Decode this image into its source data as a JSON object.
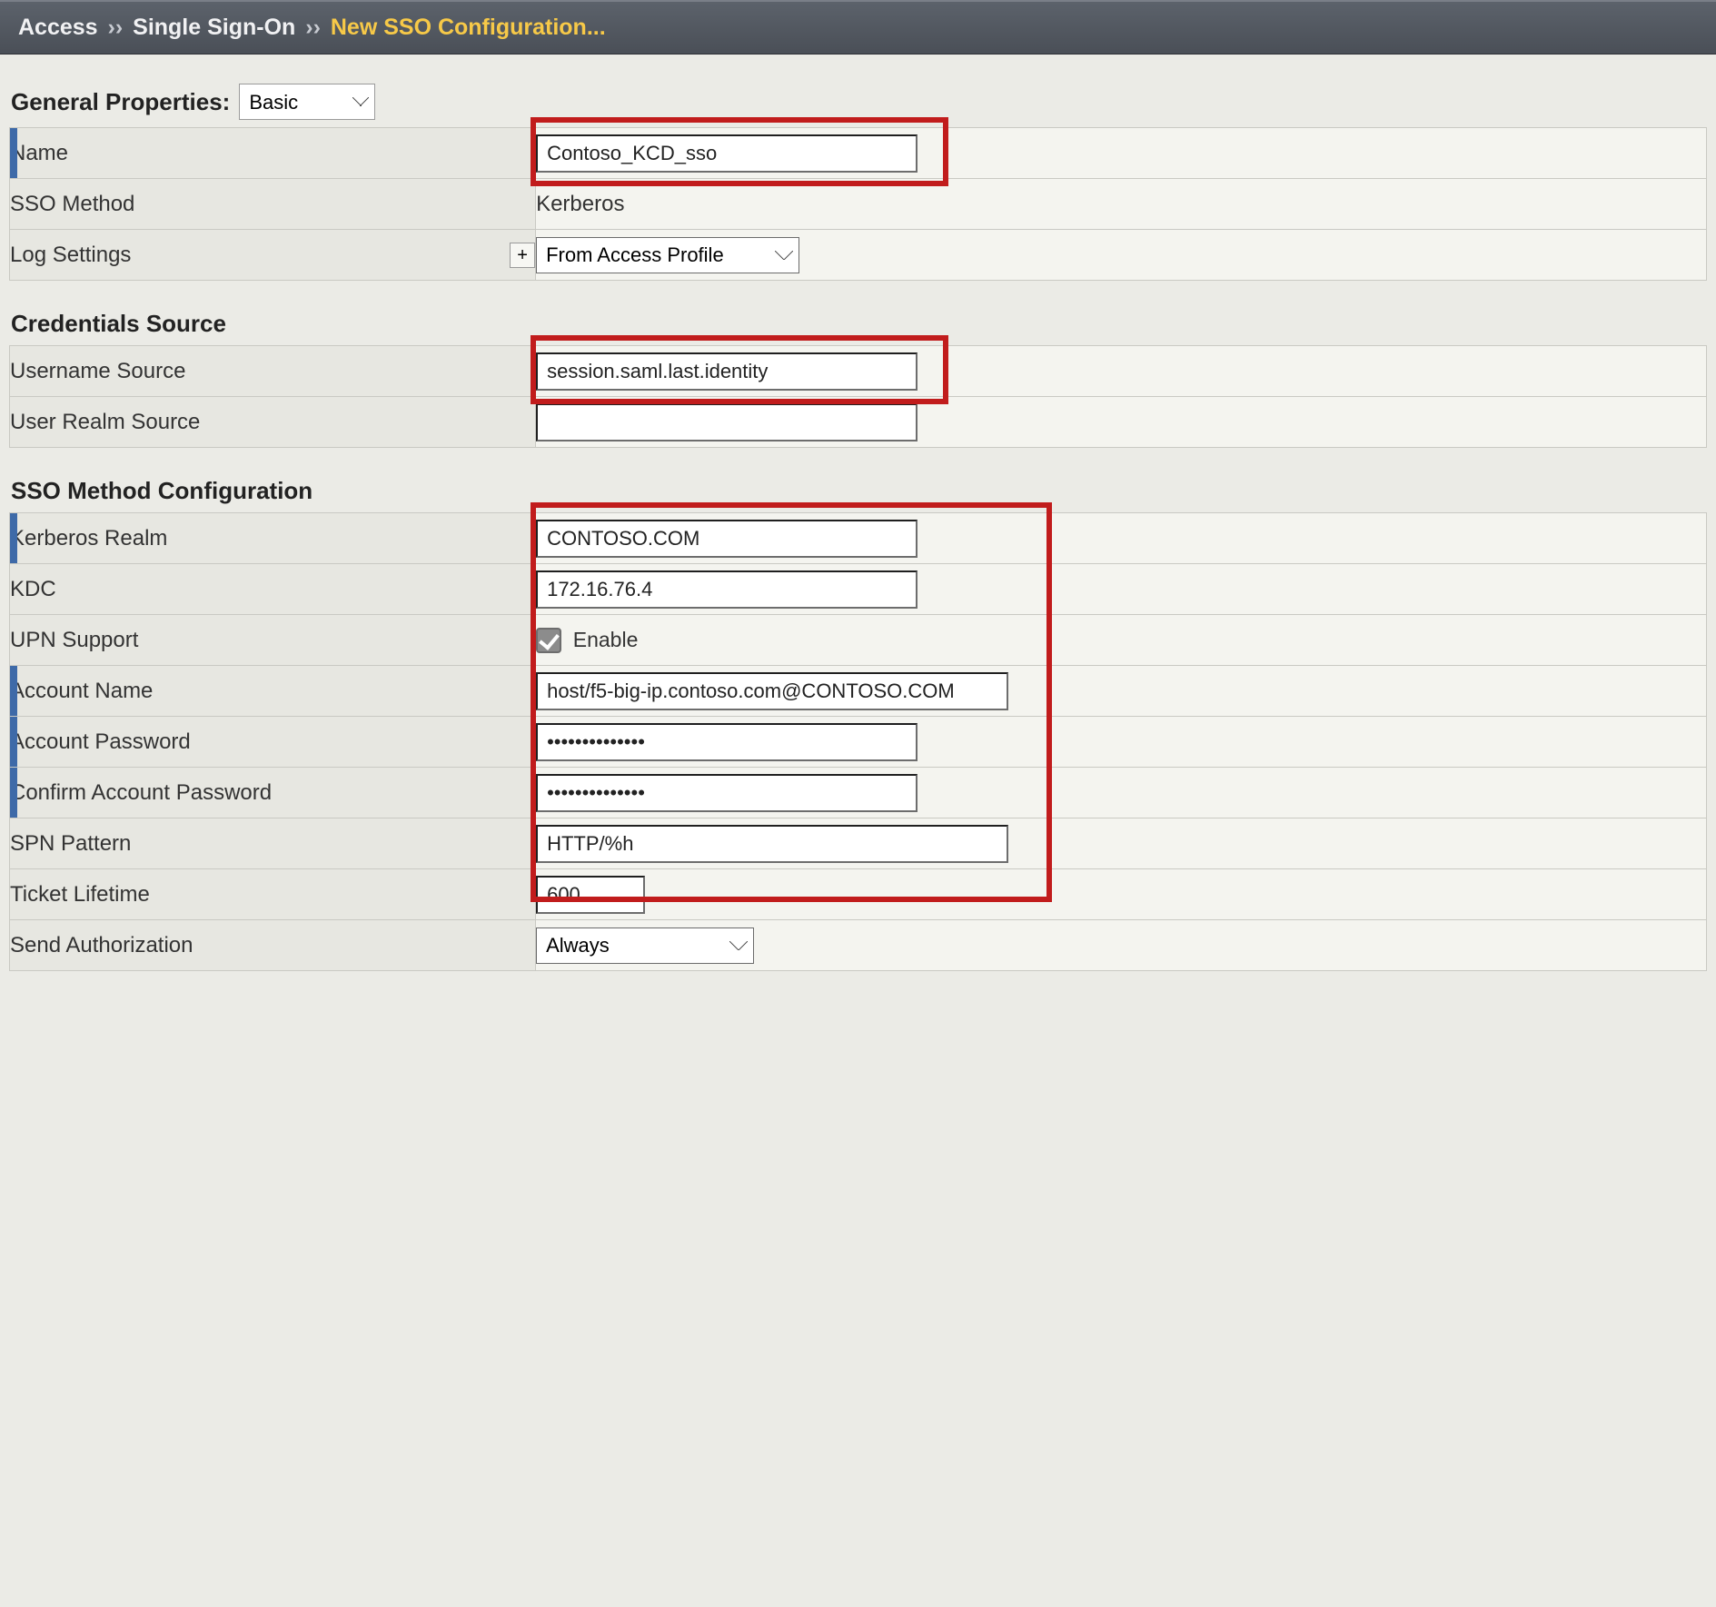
{
  "breadcrumb": {
    "level1": "Access",
    "level2": "Single Sign-On",
    "level3": "New SSO Configuration...",
    "sep": "››"
  },
  "sections": {
    "general": {
      "title": "General Properties:",
      "mode": "Basic",
      "fields": {
        "name_label": "Name",
        "name_value": "Contoso_KCD_sso",
        "sso_method_label": "SSO Method",
        "sso_method_value": "Kerberos",
        "log_settings_label": "Log Settings",
        "log_settings_plus": "+",
        "log_settings_value": "From Access Profile"
      }
    },
    "credentials": {
      "title": "Credentials Source",
      "fields": {
        "username_source_label": "Username Source",
        "username_source_value": "session.saml.last.identity",
        "user_realm_source_label": "User Realm Source",
        "user_realm_source_value": ""
      }
    },
    "method": {
      "title": "SSO Method Configuration",
      "fields": {
        "kerberos_realm_label": "Kerberos Realm",
        "kerberos_realm_value": "CONTOSO.COM",
        "kdc_label": "KDC",
        "kdc_value": "172.16.76.4",
        "upn_support_label": "UPN Support",
        "upn_support_checkbox_label": "Enable",
        "upn_support_checked": true,
        "account_name_label": "Account Name",
        "account_name_value": "host/f5-big-ip.contoso.com@CONTOSO.COM",
        "account_password_label": "Account Password",
        "account_password_value": "••••••••••••••",
        "confirm_password_label": "Confirm Account Password",
        "confirm_password_value": "••••••••••••••",
        "spn_pattern_label": "SPN Pattern",
        "spn_pattern_value": "HTTP/%h",
        "ticket_lifetime_label": "Ticket Lifetime",
        "ticket_lifetime_value": "600",
        "send_authorization_label": "Send Authorization",
        "send_authorization_value": "Always"
      }
    }
  }
}
